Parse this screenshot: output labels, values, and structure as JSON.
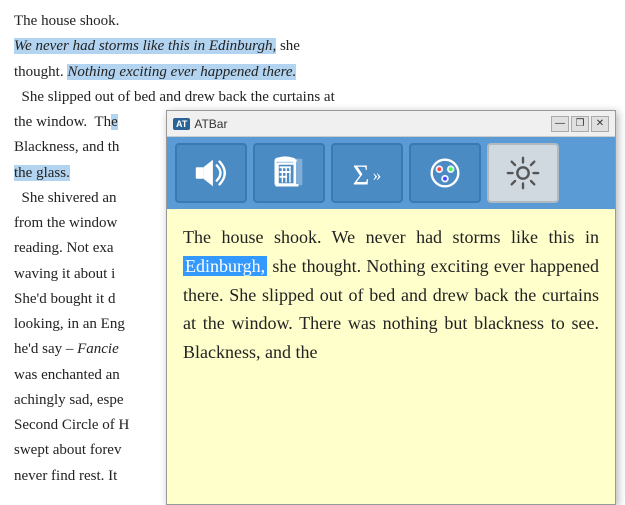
{
  "background": {
    "paragraphs": [
      {
        "id": "p1",
        "text": "The house shook.",
        "selected": false
      },
      {
        "id": "p2",
        "parts": [
          {
            "text": "We never had storms like this in Edinburgh,",
            "italic": true,
            "selected": true
          },
          {
            "text": " she"
          }
        ]
      },
      {
        "id": "p3",
        "parts": [
          {
            "text": "thought. "
          },
          {
            "text": "Nothing exciting ever happened there.",
            "italic": true,
            "selected": true
          }
        ]
      },
      {
        "id": "p4",
        "text": "  She slipped out of bed and drew back the curtains at"
      },
      {
        "id": "p5",
        "parts": [
          {
            "text": "the window.  Th"
          },
          {
            "text": "e"
          }
        ]
      },
      {
        "id": "p6",
        "text": "Blackness, and th"
      },
      {
        "id": "p7",
        "parts": [
          {
            "text": "the glass.",
            "selected": true
          }
        ]
      },
      {
        "id": "p8",
        "text": "  She shivered an"
      },
      {
        "id": "p9",
        "text": "from the window"
      },
      {
        "id": "p10",
        "text": "reading. Not exa"
      },
      {
        "id": "p11",
        "text": "waving it about i"
      },
      {
        "id": "p12",
        "text": "She'd bought it d"
      },
      {
        "id": "p13",
        "text": "looking, in an Eng"
      },
      {
        "id": "p14",
        "parts": [
          {
            "text": "he'd say – "
          },
          {
            "text": "Fancie",
            "italic": true
          }
        ]
      },
      {
        "id": "p15",
        "text": "was enchanted an"
      },
      {
        "id": "p16",
        "text": "achingly sad, espe"
      },
      {
        "id": "p17",
        "text": "Second Circle of H"
      },
      {
        "id": "p18",
        "text": "swept about forev"
      },
      {
        "id": "p19",
        "text": "never find rest. It"
      }
    ]
  },
  "atbar": {
    "title": "ATBar",
    "logo": "AT",
    "buttons": [
      {
        "id": "speaker",
        "icon": "speaker",
        "label": "Text to Speech"
      },
      {
        "id": "dictionary",
        "icon": "dictionary",
        "label": "Dictionary"
      },
      {
        "id": "summarise",
        "icon": "sigma",
        "label": "Summarise"
      },
      {
        "id": "colour",
        "icon": "colour",
        "label": "Colour Overlay"
      },
      {
        "id": "settings",
        "icon": "settings",
        "label": "Settings"
      }
    ],
    "content": {
      "text_before_highlight": "The house shook. We never had storms like this in ",
      "highlight": "Edinburgh,",
      "text_after_highlight": " she thought. Nothing exciting ever happened there. She slipped out of bed and drew back the curtains at the window. There was nothing but blackness to see. Blackness, and the"
    },
    "window_controls": {
      "minimize": "—",
      "restore": "❐",
      "close": "✕"
    }
  }
}
